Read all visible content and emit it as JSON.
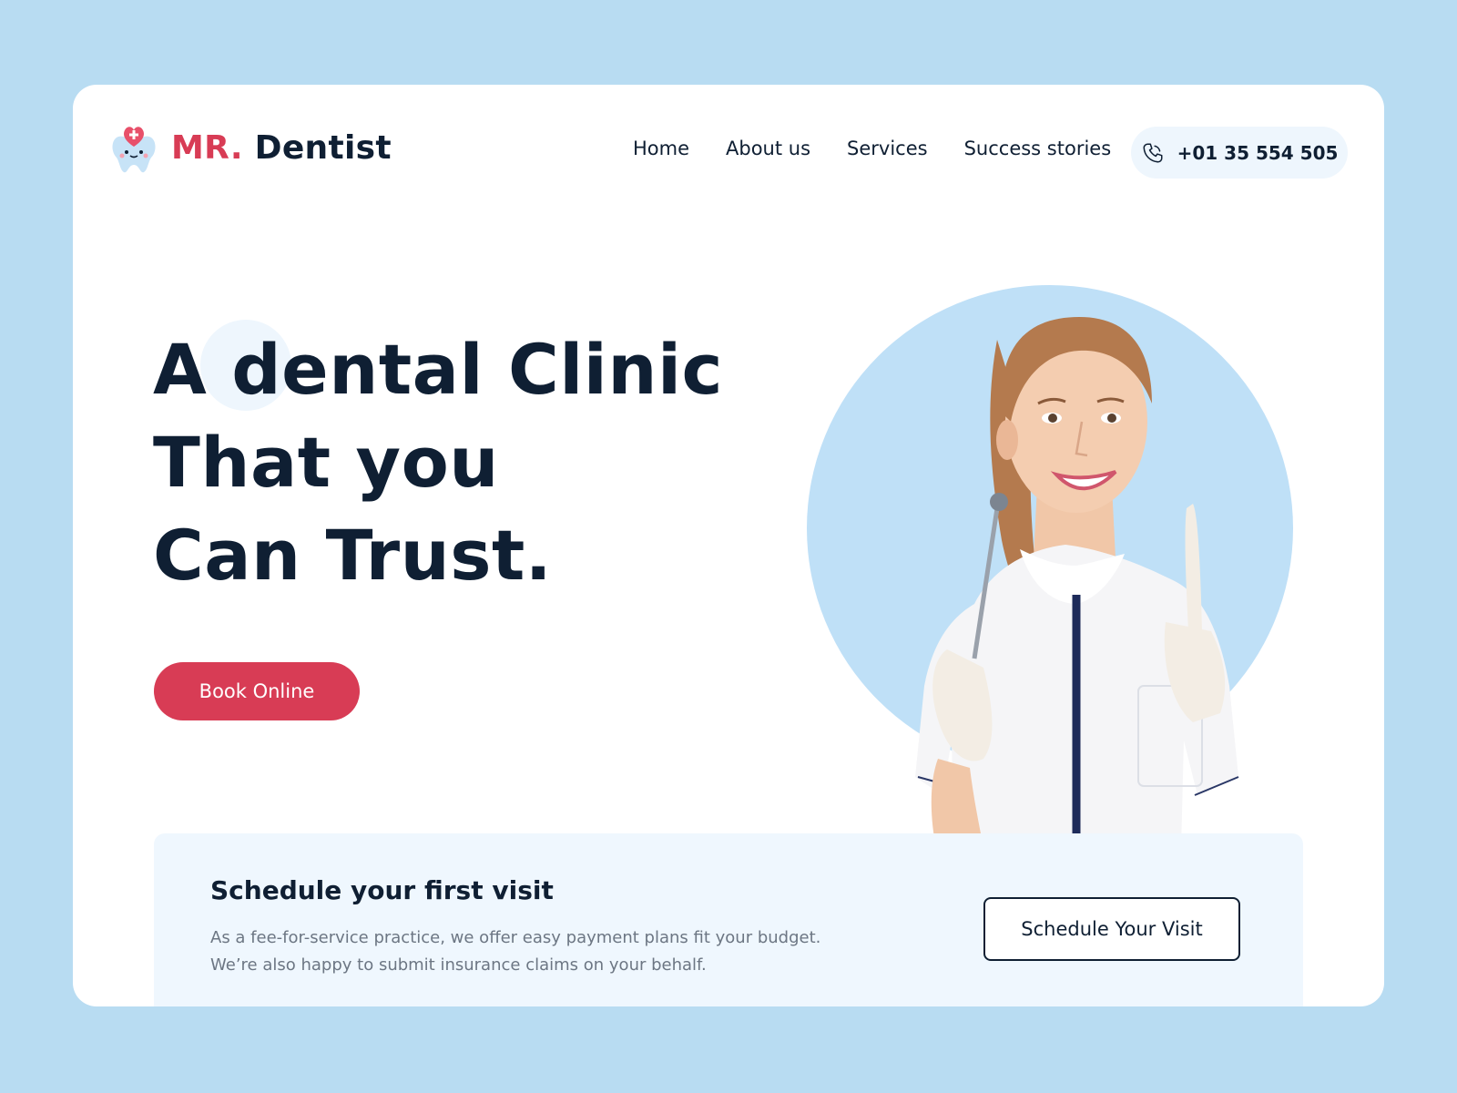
{
  "brand": {
    "prefix": "MR.",
    "name": "Dentist",
    "logo_icon": "tooth-heart-icon",
    "accent_color": "#d83c55",
    "text_color": "#0f1f33"
  },
  "nav": {
    "items": [
      {
        "label": "Home"
      },
      {
        "label": "About us"
      },
      {
        "label": "Services"
      },
      {
        "label": "Success stories"
      }
    ]
  },
  "contact": {
    "phone": "+01 35 554 505",
    "icon": "phone-icon"
  },
  "hero": {
    "title_lines": [
      "A dental Clinic",
      "That you",
      "Can Trust."
    ],
    "cta_label": "Book Online",
    "photo": "dentist-woman-holding-mirror"
  },
  "schedule": {
    "title": "Schedule your first visit",
    "description_lines": [
      "As a fee-for-service practice, we offer easy payment plans fit your budget.",
      "We’re also happy to submit insurance claims on your behalf."
    ],
    "button_label": "Schedule Your Visit"
  },
  "colors": {
    "page_background": "#b8dcf2",
    "card_background": "#ffffff",
    "hero_circle": "#bfe0f7",
    "panel_background": "#eff7fe"
  }
}
